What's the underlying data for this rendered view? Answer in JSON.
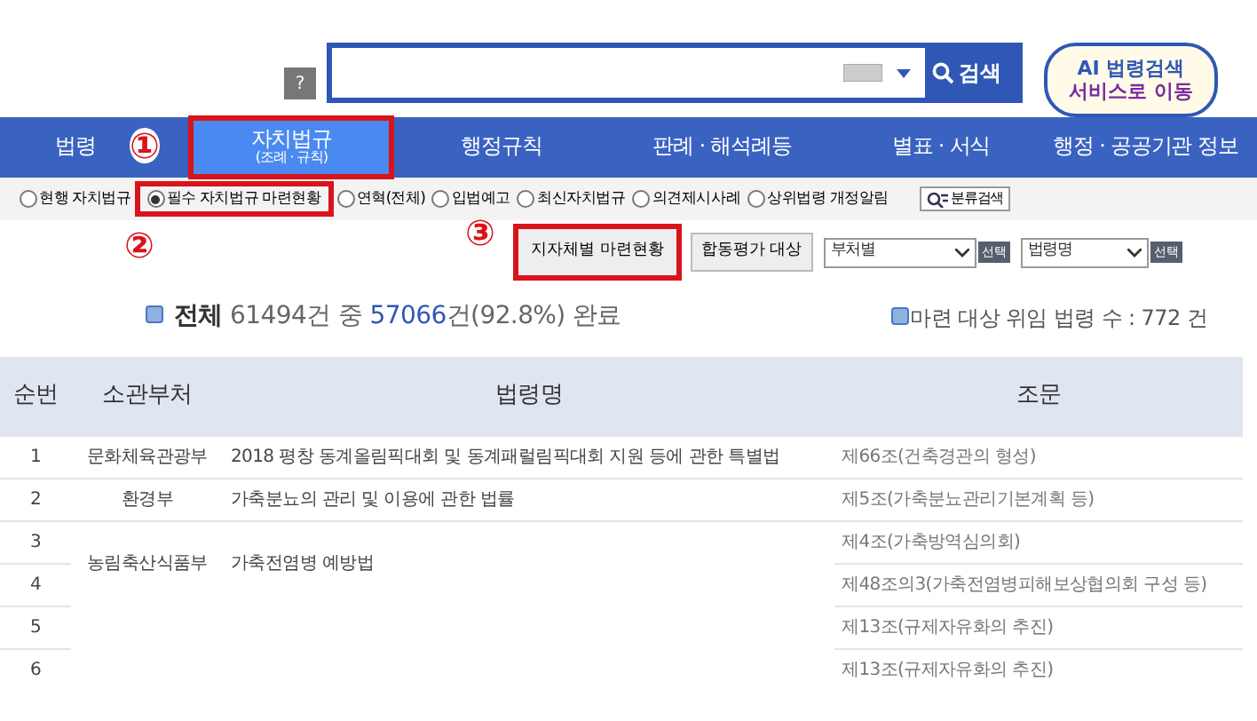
{
  "search": {
    "help": "?",
    "button": "검색"
  },
  "ai_button": {
    "lines": [
      "AI 법령검색",
      "서비스로 이동"
    ]
  },
  "nav": [
    {
      "label": "법령",
      "selected": false,
      "highlighted": false
    },
    {
      "label": "자치법규",
      "sublabel": "(조례 · 규칙)",
      "selected": true,
      "highlighted": true
    },
    {
      "label": "행정규칙",
      "selected": false,
      "highlighted": false
    },
    {
      "label": "판례 · 해석례등",
      "selected": false,
      "highlighted": false
    },
    {
      "label": "별표 · 서식",
      "selected": false,
      "highlighted": false
    },
    {
      "label": "행정 · 공공기관 정보",
      "selected": false,
      "highlighted": false
    }
  ],
  "radios": [
    {
      "label": "현행 자치법규",
      "selected": false,
      "highlighted": false
    },
    {
      "label": "필수 자치법규 마련현황",
      "selected": true,
      "highlighted": true
    },
    {
      "label": "연혁(전체)",
      "selected": false,
      "highlighted": false
    },
    {
      "label": "입법예고",
      "selected": false,
      "highlighted": false
    },
    {
      "label": "최신자치법규",
      "selected": false,
      "highlighted": false
    },
    {
      "label": "의견제시사례",
      "selected": false,
      "highlighted": false
    },
    {
      "label": "상위법령 개정알림",
      "selected": false,
      "highlighted": false
    }
  ],
  "classify_button": "분류검색",
  "annotations": [
    {
      "label": "①"
    },
    {
      "label": "②"
    },
    {
      "label": "③"
    }
  ],
  "actions": {
    "buttons": [
      {
        "label": "지자체별 마련현황",
        "highlighted": true
      },
      {
        "label": "합동평가 대상",
        "highlighted": false
      }
    ],
    "selects": [
      {
        "value": "부처별",
        "button": "선택"
      },
      {
        "value": "법령명",
        "button": "선택"
      }
    ]
  },
  "summary": {
    "parts": [
      {
        "kind": "label",
        "text": "전체"
      },
      {
        "kind": "plain",
        "text": " 61494건 중 "
      },
      {
        "kind": "accent",
        "text": "57066"
      },
      {
        "kind": "plain",
        "text": "건(92.8%) 완료"
      }
    ],
    "right": "마련 대상 위임 법령 수 : 772 건"
  },
  "table": {
    "columns": [
      "순번",
      "소관부처",
      "법령명",
      "조문"
    ],
    "rows": [
      {
        "no": "1",
        "dept": "문화체육관광부",
        "law": "2018 평창 동계올림픽대회 및 동계패럴림픽대회 지원 등에 관한 특별법",
        "article": "제66조(건축경관의 형성)"
      },
      {
        "no": "2",
        "dept": "환경부",
        "law": "가축분뇨의 관리 및 이용에 관한 법률",
        "article": "제5조(가축분뇨관리기본계획 등)"
      },
      {
        "no": "3",
        "dept": "농림축산식품부",
        "law": "가축전염병 예방법",
        "merged_with_next": true,
        "article": "제4조(가축방역심의회)"
      },
      {
        "no": "4",
        "article": "제48조의3(가축전염병피해보상협의회 구성 등)"
      },
      {
        "no": "5",
        "article": "제13조(규제자유화의 추진)"
      },
      {
        "no": "6",
        "article": "제13조(규제자유화의 추진)"
      }
    ]
  }
}
